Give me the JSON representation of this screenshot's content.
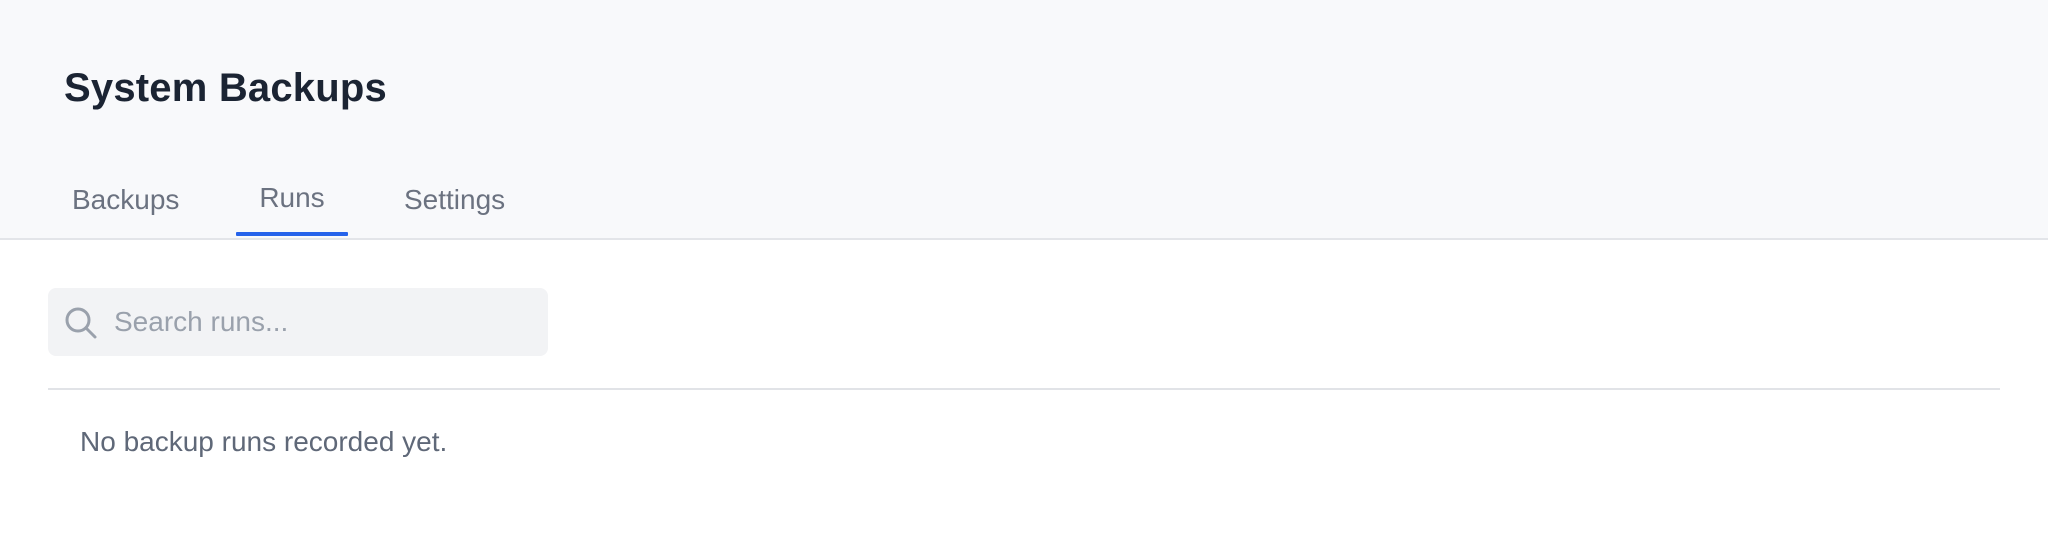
{
  "header": {
    "title": "System Backups"
  },
  "tabs": [
    {
      "label": "Backups",
      "active": false
    },
    {
      "label": "Runs",
      "active": true
    },
    {
      "label": "Settings",
      "active": false
    }
  ],
  "search": {
    "placeholder": "Search runs...",
    "value": "",
    "icon": "search-icon"
  },
  "runs": {
    "empty_message": "No backup runs recorded yet."
  },
  "colors": {
    "accent": "#2563eb",
    "header_bg": "#f8f9fb",
    "title": "#1b2433",
    "muted_text": "#6b7280"
  }
}
